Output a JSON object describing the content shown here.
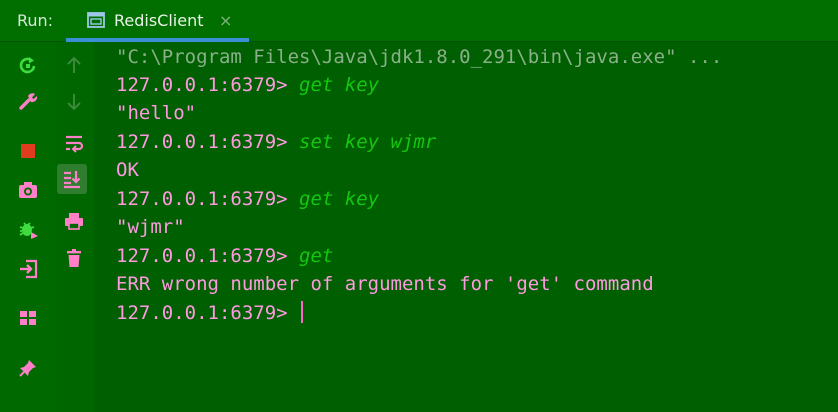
{
  "header": {
    "run_label": "Run:",
    "tab": {
      "title": "RedisClient",
      "close_glyph": "×",
      "icon": "console-window-icon",
      "accent": "#3b8fd6"
    }
  },
  "toolbar_left": [
    {
      "name": "rerun-icon",
      "color": "#3fdc3f"
    },
    {
      "name": "wrench-icon",
      "color": "#ff80c8"
    },
    {
      "name": "stop-icon",
      "color": "#e03c1e"
    },
    {
      "name": "camera-icon",
      "color": "#ff80c8"
    },
    {
      "name": "debug-bug-icon",
      "color": "#3fdc3f"
    },
    {
      "name": "exit-icon",
      "color": "#ff80c8"
    },
    {
      "name": "layout-icon",
      "color": "#ff80c8"
    },
    {
      "name": "pin-icon",
      "color": "#ff80c8"
    }
  ],
  "toolbar_second": [
    {
      "name": "arrow-up-icon",
      "color": "#3b8a3b"
    },
    {
      "name": "arrow-down-icon",
      "color": "#3b8a3b"
    },
    {
      "name": "soft-wrap-icon",
      "color": "#ff80c8"
    },
    {
      "name": "scroll-to-end-icon",
      "color": "#ff80c8",
      "active": true
    },
    {
      "name": "print-icon",
      "color": "#ff80c8"
    },
    {
      "name": "trash-icon",
      "color": "#ff80c8"
    }
  ],
  "console": {
    "lines": [
      {
        "type": "info",
        "text": "\"C:\\Program Files\\Java\\jdk1.8.0_291\\bin\\java.exe\" ..."
      },
      {
        "type": "input",
        "prompt": "127.0.0.1:6379> ",
        "command": "get key"
      },
      {
        "type": "output",
        "text": "\"hello\""
      },
      {
        "type": "input",
        "prompt": "127.0.0.1:6379> ",
        "command": "set key wjmr"
      },
      {
        "type": "output",
        "text": "OK"
      },
      {
        "type": "input",
        "prompt": "127.0.0.1:6379> ",
        "command": "get key"
      },
      {
        "type": "output",
        "text": "\"wjmr\""
      },
      {
        "type": "input",
        "prompt": "127.0.0.1:6379> ",
        "command": "get"
      },
      {
        "type": "output",
        "text": "ERR wrong number of arguments for 'get' command"
      },
      {
        "type": "input",
        "prompt": "127.0.0.1:6379> ",
        "command": ""
      }
    ],
    "prompt_color": "#ff99e0",
    "command_color": "#14c60f"
  }
}
